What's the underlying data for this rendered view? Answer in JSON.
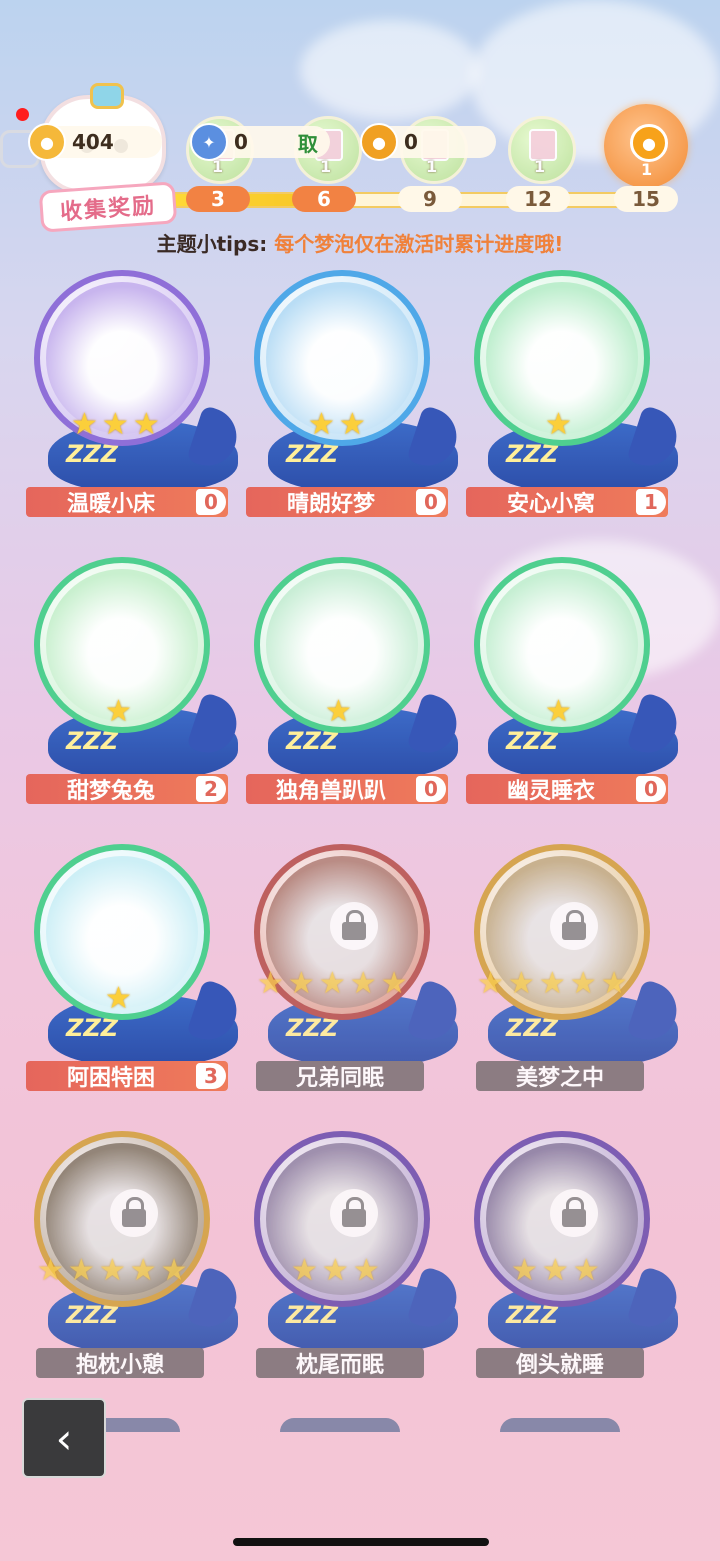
{
  "hud": {
    "coin_amount": "404",
    "ticket_amount": "0",
    "badge_amount": "0",
    "milestone_counts": [
      "1",
      "1",
      "1",
      "1",
      "1"
    ],
    "milestone_steps": [
      "3",
      "6",
      "9",
      "12",
      "15"
    ],
    "progress_fraction": 0.37,
    "collect_label": "收集奖励",
    "overlay_text": "取"
  },
  "tips": {
    "prefix": "主题小tips: ",
    "text": "每个梦泡仅在激活时累计进度哦!"
  },
  "items": [
    {
      "name": "温暖小床",
      "count": "0",
      "stars": 3,
      "locked": false,
      "ring": "#8f6fd8",
      "fill": "#c8b5ee"
    },
    {
      "name": "晴朗好梦",
      "count": "0",
      "stars": 2,
      "locked": false,
      "ring": "#4fa8e8",
      "fill": "#b9ddf5"
    },
    {
      "name": "安心小窝",
      "count": "1",
      "stars": 1,
      "locked": false,
      "ring": "#4fcf8f",
      "fill": "#bdeecd"
    },
    {
      "name": "甜梦兔兔",
      "count": "2",
      "stars": 1,
      "locked": false,
      "ring": "#4fcf8f",
      "fill": "#c9f0cf"
    },
    {
      "name": "独角兽趴趴",
      "count": "0",
      "stars": 1,
      "locked": false,
      "ring": "#4fcf8f",
      "fill": "#c9eed6"
    },
    {
      "name": "幽灵睡衣",
      "count": "0",
      "stars": 1,
      "locked": false,
      "ring": "#4fcf8f",
      "fill": "#c6efd3"
    },
    {
      "name": "阿困特困",
      "count": "3",
      "stars": 1,
      "locked": false,
      "ring": "#4fcf8f",
      "fill": "#cdeff6"
    },
    {
      "name": "兄弟同眠",
      "count": "",
      "stars": 5,
      "locked": true,
      "ring": "#b8524e",
      "fill": "#d98f7c"
    },
    {
      "name": "美梦之中",
      "count": "",
      "stars": 5,
      "locked": true,
      "ring": "#d3a13e",
      "fill": "#e2c17e"
    },
    {
      "name": "抱枕小憩",
      "count": "",
      "stars": 5,
      "locked": true,
      "ring": "#d3a13e",
      "fill": "#9a8b6f"
    },
    {
      "name": "枕尾而眠",
      "count": "",
      "stars": 3,
      "locked": true,
      "ring": "#6d4fae",
      "fill": "#a896c8"
    },
    {
      "name": "倒头就睡",
      "count": "",
      "stars": 3,
      "locked": true,
      "ring": "#6d4fae",
      "fill": "#9e8cc4"
    }
  ],
  "icons": {
    "back": "chevron-left-icon",
    "lock": "lock-icon",
    "star": "star-icon",
    "coin": "coin-icon"
  },
  "back_label": "‹"
}
